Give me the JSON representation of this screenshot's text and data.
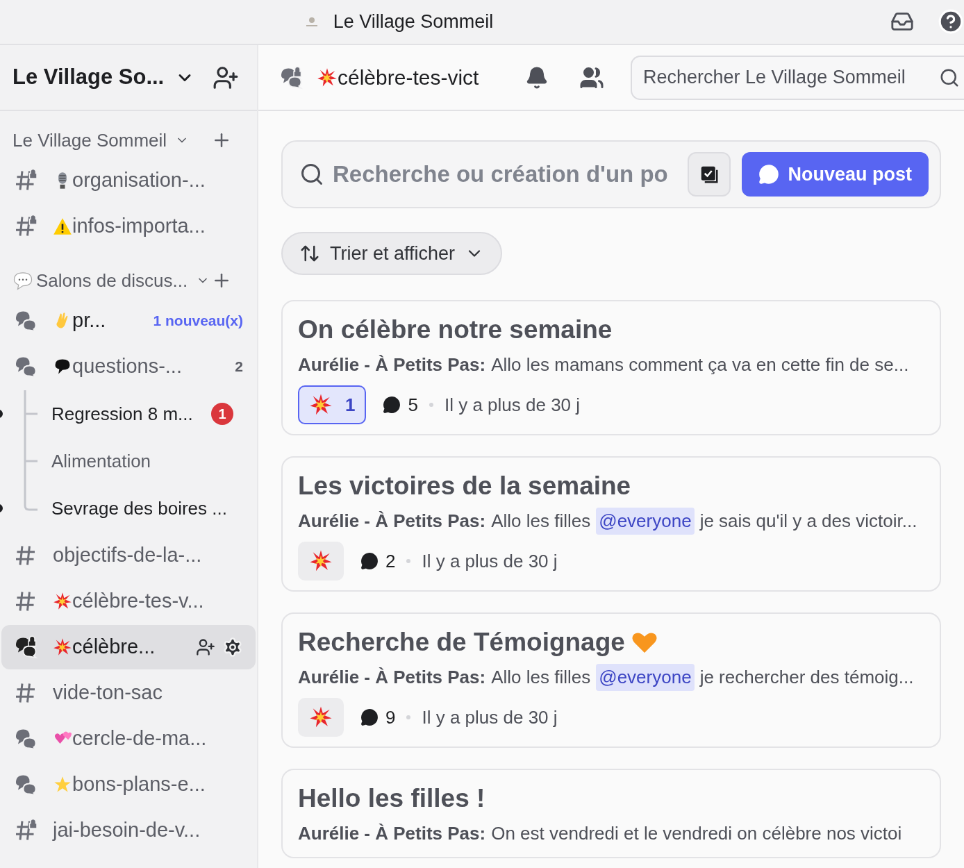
{
  "window": {
    "title": "Le Village Sommeil"
  },
  "server": {
    "name": "Le Village So..."
  },
  "sections": [
    {
      "title": "Le Village Sommeil",
      "has_icon": false,
      "channels": [
        {
          "kind": "locked-text",
          "emoji": {
            "kind": "mic"
          },
          "name": "organisation-...",
          "selected": false,
          "unread": false
        },
        {
          "kind": "locked-text",
          "emoji": {
            "kind": "warning"
          },
          "name": "infos-importa...",
          "selected": false,
          "unread": false
        }
      ]
    },
    {
      "title": "Salons de discus...",
      "has_icon": true,
      "channels": [
        {
          "kind": "forum",
          "emoji": {
            "kind": "wave"
          },
          "name": "pr...",
          "selected": false,
          "unread": true,
          "new_badge": "1 nouveau(x)"
        },
        {
          "kind": "forum",
          "emoji": {
            "kind": "bubble"
          },
          "name": "questions-...",
          "selected": false,
          "unread": false,
          "count": "2"
        },
        {
          "kind": "thread",
          "name": "Regression 8 m...",
          "selected": false,
          "unread": true,
          "mentions": "1"
        },
        {
          "kind": "thread",
          "name": "Alimentation",
          "selected": false,
          "unread": false
        },
        {
          "kind": "thread",
          "name": "Sevrage des boires ...",
          "selected": false,
          "unread": true
        },
        {
          "kind": "text",
          "name": "objectifs-de-la-...",
          "selected": false,
          "unread": false
        },
        {
          "kind": "text",
          "emoji": {
            "kind": "explosion"
          },
          "name": "célèbre-tes-v...",
          "selected": false,
          "unread": false
        },
        {
          "kind": "locked-forum",
          "emoji": {
            "kind": "explosion"
          },
          "name": "célèbre...",
          "selected": true,
          "unread": false
        },
        {
          "kind": "text",
          "name": "vide-ton-sac",
          "selected": false,
          "unread": false
        },
        {
          "kind": "forum",
          "emoji": {
            "kind": "hearts"
          },
          "name": "cercle-de-ma...",
          "selected": false,
          "unread": false
        },
        {
          "kind": "forum",
          "emoji": {
            "kind": "star"
          },
          "name": "bons-plans-e...",
          "selected": false,
          "unread": false
        },
        {
          "kind": "locked-text",
          "name": "jai-besoin-de-v...",
          "selected": false,
          "unread": false
        }
      ]
    }
  ],
  "channel_header": {
    "name": "célèbre-tes-vict",
    "search": {
      "placeholder": "Rechercher Le Village Sommeil"
    }
  },
  "forum": {
    "search": {
      "placeholder": "Recherche ou création d'un po"
    },
    "new_post": "Nouveau post",
    "sort": "Trier et afficher"
  },
  "posts": [
    {
      "title": "On célèbre notre semaine",
      "author": "Aurélie - À Petits Pas:",
      "excerpt_before": "Allo les mamans comment ça va en cette fin de se...",
      "reactions": "1",
      "reacted": true,
      "comments": "5",
      "time": "Il y a plus de 30 j"
    },
    {
      "title": "Les victoires de la semaine",
      "author": "Aurélie - À Petits Pas:",
      "excerpt_before": "Allo les filles",
      "mention": "@everyone",
      "excerpt_after": "je sais qu'il y a des victoir...",
      "reacted": false,
      "comments": "2",
      "time": "Il y a plus de 30 j"
    },
    {
      "title": "Recherche de Témoignage",
      "title_emoji": {
        "kind": "heart"
      },
      "author": "Aurélie - À Petits Pas:",
      "excerpt_before": "Allo les filles",
      "mention": "@everyone",
      "excerpt_after": "je rechercher des témoig...",
      "reacted": false,
      "comments": "9",
      "time": "Il y a plus de 30 j"
    },
    {
      "title": "Hello les filles !",
      "author": "Aurélie - À Petits Pas:",
      "excerpt_before": "On est vendredi et le vendredi on célèbre nos victoi"
    }
  ]
}
